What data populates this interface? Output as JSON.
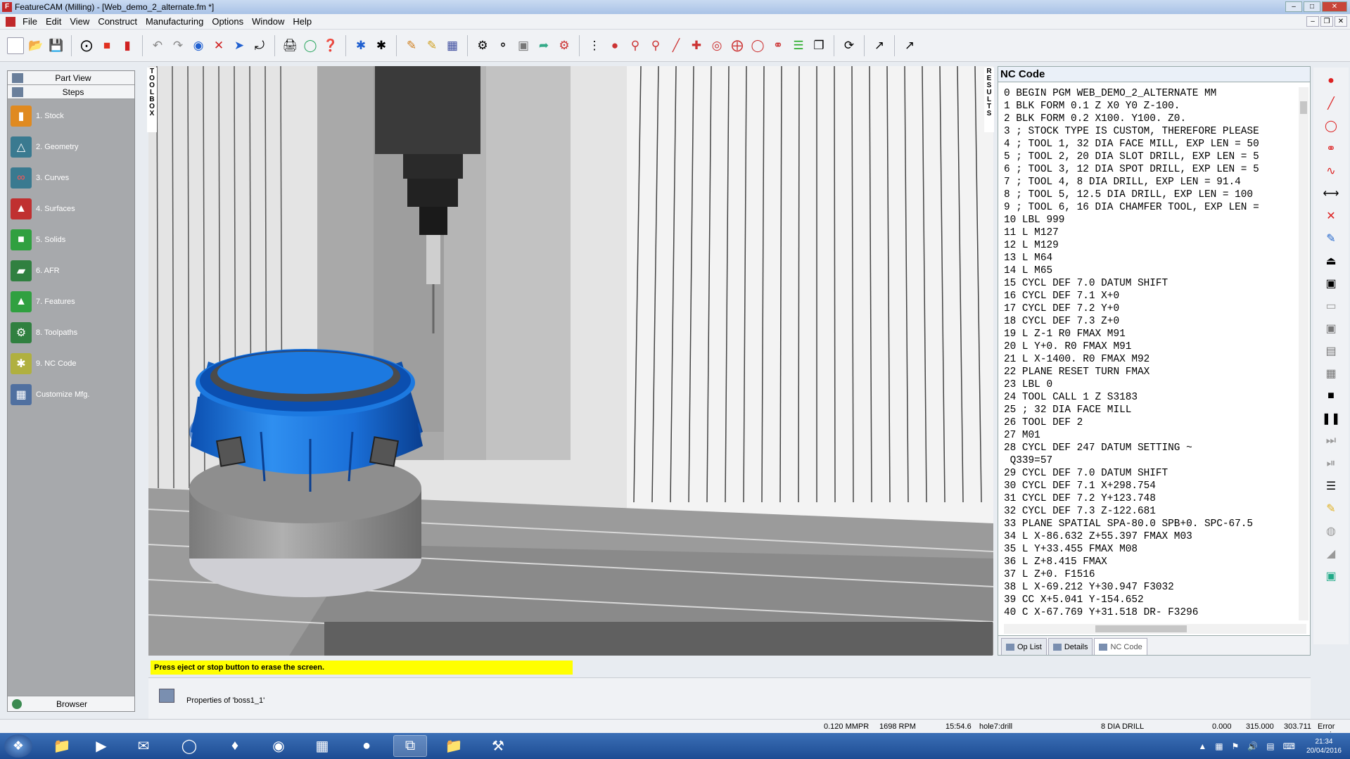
{
  "window": {
    "title": "FeatureCAM (Milling) - [Web_demo_2_alternate.fm *]"
  },
  "menu": [
    "File",
    "Edit",
    "View",
    "Construct",
    "Manufacturing",
    "Options",
    "Window",
    "Help"
  ],
  "left_panel": {
    "part_view": "Part View",
    "steps": "Steps",
    "items": [
      "1. Stock",
      "2. Geometry",
      "3. Curves",
      "4. Surfaces",
      "5. Solids",
      "6. AFR",
      "7. Features",
      "8. Toolpaths",
      "9. NC Code",
      "Customize Mfg."
    ],
    "browser": "Browser"
  },
  "toolbox_label": "TOOLBOX",
  "results_label": "RESULTS",
  "nc_panel": {
    "title": "NC Code",
    "lines": [
      "0 BEGIN PGM WEB_DEMO_2_ALTERNATE MM",
      "1 BLK FORM 0.1 Z X0 Y0 Z-100.",
      "2 BLK FORM 0.2 X100. Y100. Z0.",
      "3 ; STOCK TYPE IS CUSTOM, THEREFORE PLEASE",
      "4 ; TOOL 1, 32 DIA FACE MILL, EXP LEN = 50",
      "5 ; TOOL 2, 20 DIA SLOT DRILL, EXP LEN = 5",
      "6 ; TOOL 3, 12 DIA SPOT DRILL, EXP LEN = 5",
      "7 ; TOOL 4, 8 DIA DRILL, EXP LEN = 91.4",
      "8 ; TOOL 5, 12.5 DIA DRILL, EXP LEN = 100",
      "9 ; TOOL 6, 16 DIA CHAMFER TOOL, EXP LEN =",
      "10 LBL 999",
      "11 L M127",
      "12 L M129",
      "13 L M64",
      "14 L M65",
      "15 CYCL DEF 7.0 DATUM SHIFT",
      "16 CYCL DEF 7.1 X+0",
      "17 CYCL DEF 7.2 Y+0",
      "18 CYCL DEF 7.3 Z+0",
      "19 L Z-1 R0 FMAX M91",
      "20 L Y+0. R0 FMAX M91",
      "21 L X-1400. R0 FMAX M92",
      "22 PLANE RESET TURN FMAX",
      "23 LBL 0",
      "24 TOOL CALL 1 Z S3183",
      "25 ; 32 DIA FACE MILL",
      "26 TOOL DEF 2",
      "27 M01",
      "28 CYCL DEF 247 DATUM SETTING ~",
      " Q339=57",
      "29 CYCL DEF 7.0 DATUM SHIFT",
      "30 CYCL DEF 7.1 X+298.754",
      "31 CYCL DEF 7.2 Y+123.748",
      "32 CYCL DEF 7.3 Z-122.681",
      "33 PLANE SPATIAL SPA-80.0 SPB+0. SPC-67.5",
      "34 L X-86.632 Z+55.397 FMAX M03",
      "35 L Y+33.455 FMAX M08",
      "36 L Z+8.415 FMAX",
      "37 L Z+0. F1516",
      "38 L X-69.212 Y+30.947 F3032",
      "39 CC X+5.041 Y-154.652",
      "40 C X-67.769 Y+31.518 DR- F3296"
    ],
    "tabs": [
      "Op List",
      "Details",
      "NC Code"
    ]
  },
  "message": "Press eject or stop button to erase the screen.",
  "properties_text": "Properties of 'boss1_1'",
  "status": {
    "feed": "0.120 MMPR",
    "rpm": "1698 RPM",
    "time": "15:54.6",
    "feature": "hole7:drill",
    "tool": "8 DIA DRILL",
    "x": "0.000",
    "y": "315.000",
    "z": "303.711",
    "error": "Error savi"
  },
  "taskbar": {
    "time": "21:34",
    "date": "20/04/2016"
  }
}
